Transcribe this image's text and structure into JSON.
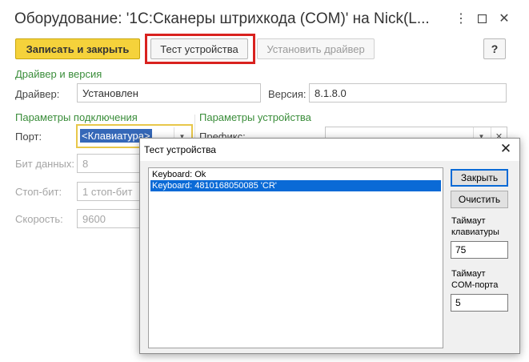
{
  "window": {
    "title": "Оборудование: '1С:Сканеры штрихкода (COM)' на Nick(L...",
    "more_icon": "more-icon",
    "maximize_icon": "maximize-icon",
    "close_icon": "close-icon"
  },
  "toolbar": {
    "save_close_label": "Записать и закрыть",
    "test_device_label": "Тест устройства",
    "install_driver_label": "Установить драйвер",
    "help_label": "?"
  },
  "driver_section": {
    "heading": "Драйвер и версия",
    "driver_label": "Драйвер:",
    "driver_value": "Установлен",
    "version_label": "Версия:",
    "version_value": "8.1.8.0"
  },
  "connection": {
    "heading": "Параметры подключения",
    "port_label": "Порт:",
    "port_value": "<Клавиатура>",
    "data_bits_label": "Бит данных:",
    "data_bits_value": "8",
    "stop_bits_label": "Стоп-бит:",
    "stop_bits_value": "1 стоп-бит",
    "speed_label": "Скорость:",
    "speed_value": "9600"
  },
  "device": {
    "heading": "Параметры устройства",
    "prefix_label": "Префикс:",
    "prefix_value": ""
  },
  "dialog": {
    "title": "Тест устройства",
    "log": [
      "Keyboard: Ok",
      "Keyboard: 4810168050085 'CR'"
    ],
    "selected_index": 1,
    "close_label": "Закрыть",
    "clear_label": "Очистить",
    "kbd_timeout_label_1": "Таймаут",
    "kbd_timeout_label_2": "клавиатуры",
    "kbd_timeout_value": "75",
    "com_timeout_label_1": "Таймаут",
    "com_timeout_label_2": "COM-порта",
    "com_timeout_value": "5"
  },
  "colors": {
    "accent_yellow": "#f5d23b",
    "section_green": "#3a8d3a",
    "highlight_red": "#d9221f",
    "selection_blue": "#0a6ad6"
  }
}
